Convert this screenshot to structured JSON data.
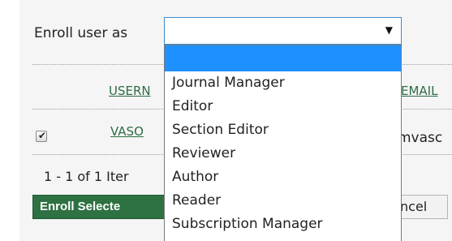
{
  "enroll": {
    "label": "Enroll user as",
    "selected_value": "",
    "options": [
      "",
      "Journal Manager",
      "Editor",
      "Section Editor",
      "Reviewer",
      "Author",
      "Reader",
      "Subscription Manager"
    ]
  },
  "table": {
    "headers": {
      "username": "USERN",
      "email": "EMAIL"
    },
    "rows": [
      {
        "checked": true,
        "username": "VASO",
        "email": "mvasc"
      }
    ]
  },
  "pager": {
    "text": "1 - 1 of 1 Iter"
  },
  "buttons": {
    "enroll_selected": "Enroll Selecte",
    "cancel": "ncel"
  },
  "colors": {
    "accent_green": "#2e7142",
    "link_green": "#2f6b47",
    "highlight_blue": "#1e90ff",
    "focus_border": "#3f89cf"
  }
}
